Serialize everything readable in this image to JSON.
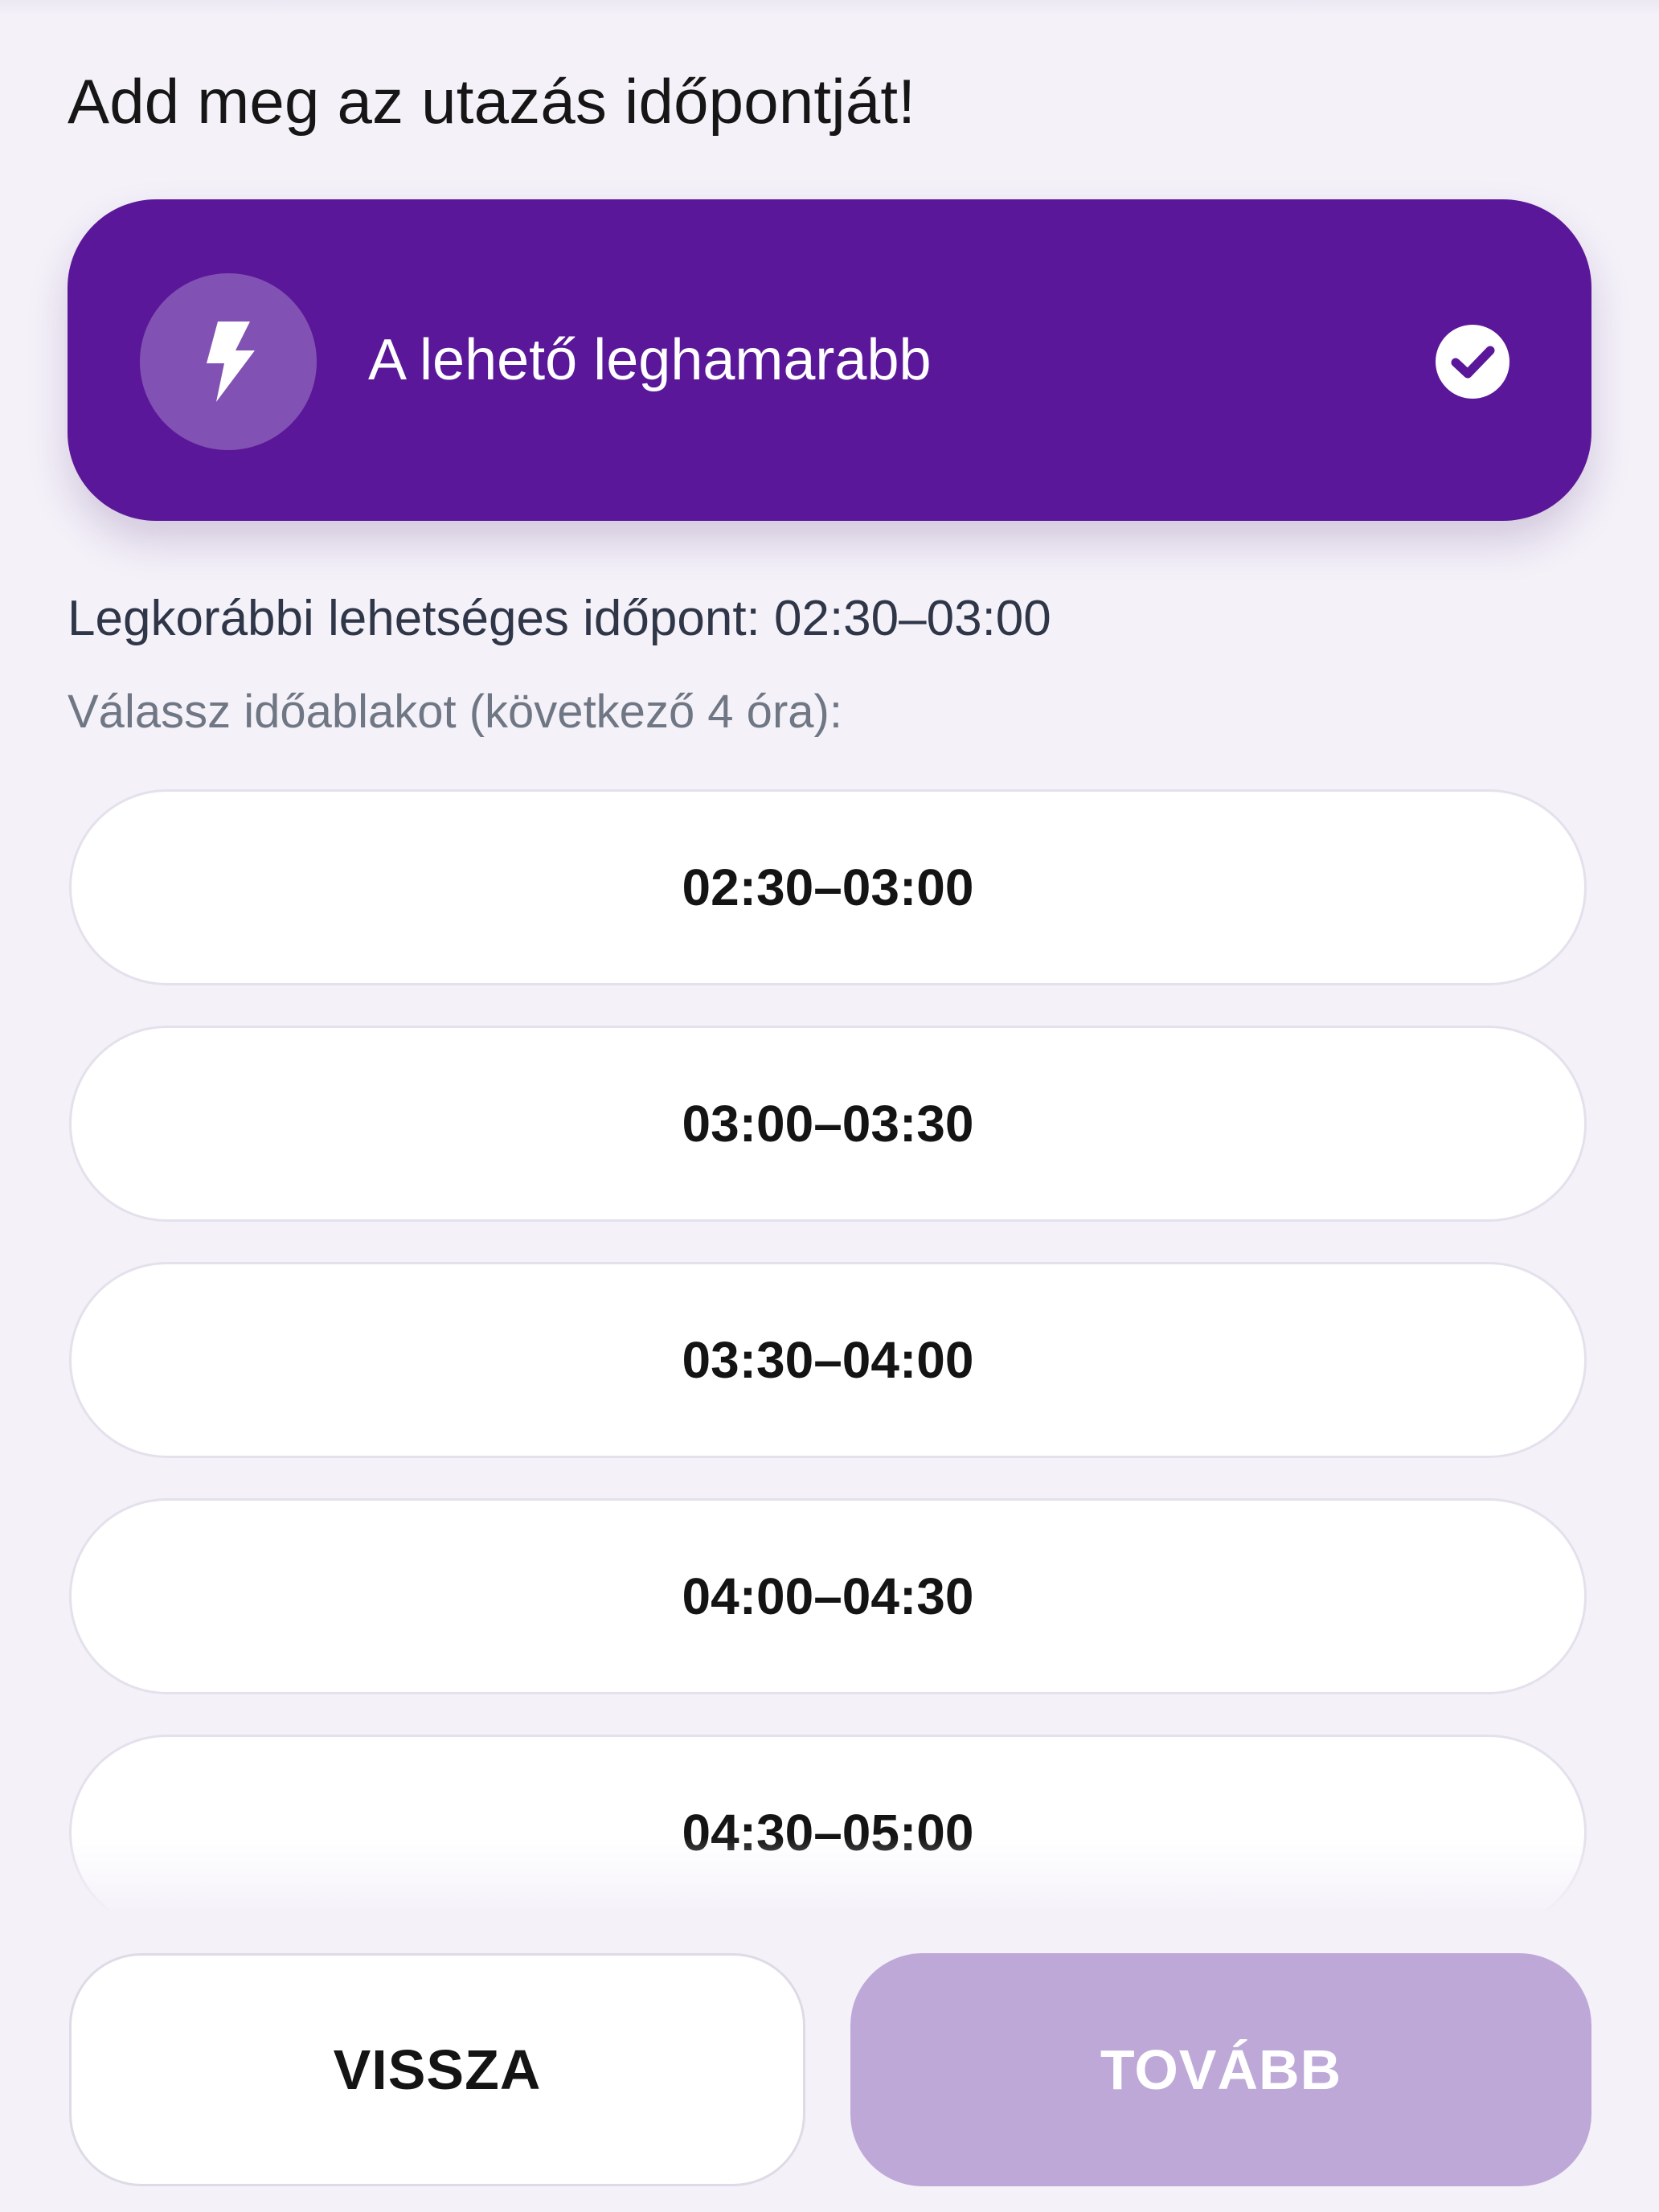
{
  "header": {
    "title": "Add meg az utazás időpontját!"
  },
  "asap_option": {
    "label": "A lehető leghamarabb",
    "icon": "lightning-icon",
    "selected": true,
    "check_icon": "check-circle-icon",
    "accent_color": "#5b1799"
  },
  "info": {
    "earliest": "Legkorábbi lehetséges időpont: 02:30–03:00",
    "hint": "Válassz időablakot (következő 4 óra):"
  },
  "slots": [
    {
      "label": "02:30–03:00"
    },
    {
      "label": "03:00–03:30"
    },
    {
      "label": "03:30–04:00"
    },
    {
      "label": "04:00–04:30"
    },
    {
      "label": "04:30–05:00"
    }
  ],
  "footer": {
    "back_label": "VISSZA",
    "next_label": "TOVÁBB",
    "next_enabled": false
  }
}
